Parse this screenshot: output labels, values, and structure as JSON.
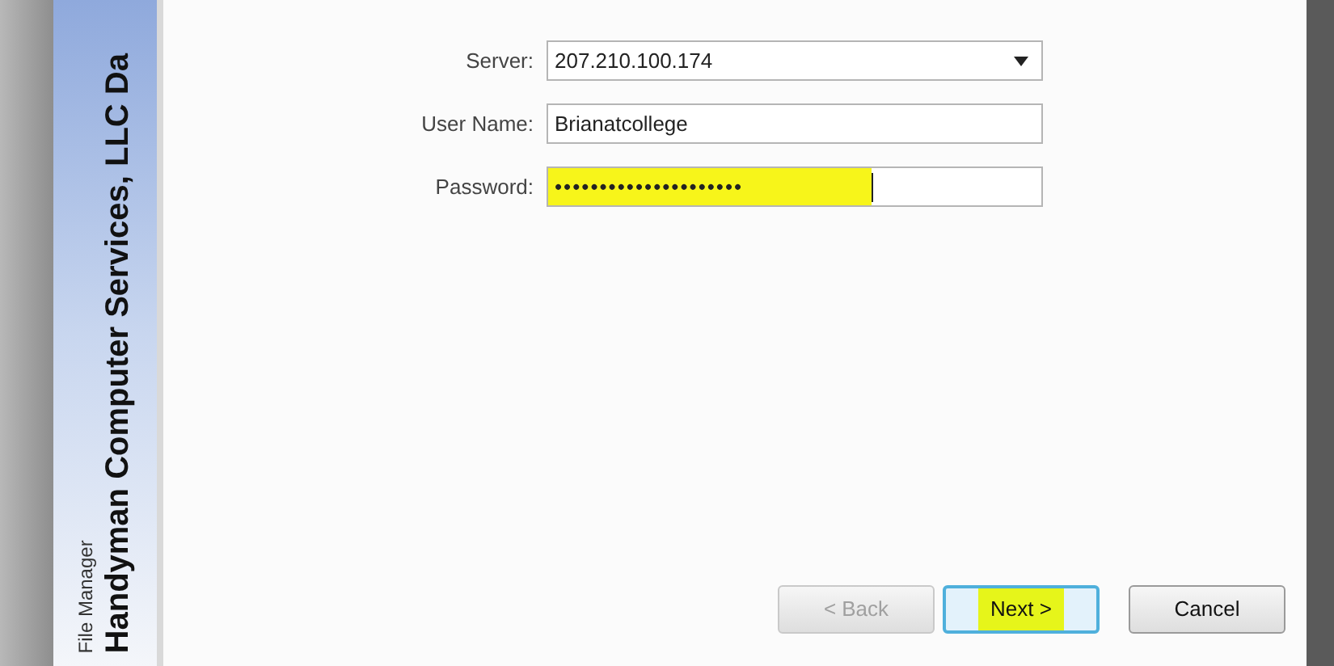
{
  "banner": {
    "title": "Handyman Computer Services, LLC Da",
    "subtitle": "File Manager"
  },
  "fields": [
    {
      "kind": "dropdown",
      "label": "Server:",
      "value": "207.210.100.174",
      "highlighted": false
    },
    {
      "kind": "text",
      "label": "User Name:",
      "value": "Brianatcollege",
      "highlighted": false
    },
    {
      "kind": "text",
      "label": "Password:",
      "value": "•••••••••••••••••••••",
      "highlighted": true
    }
  ],
  "buttons": [
    {
      "label": "< Back",
      "disabled": true,
      "default": false,
      "highlighted": false
    },
    {
      "label": "Next >",
      "disabled": false,
      "default": true,
      "highlighted": true
    },
    {
      "label": "Cancel",
      "disabled": false,
      "default": false,
      "highlighted": false
    }
  ]
}
